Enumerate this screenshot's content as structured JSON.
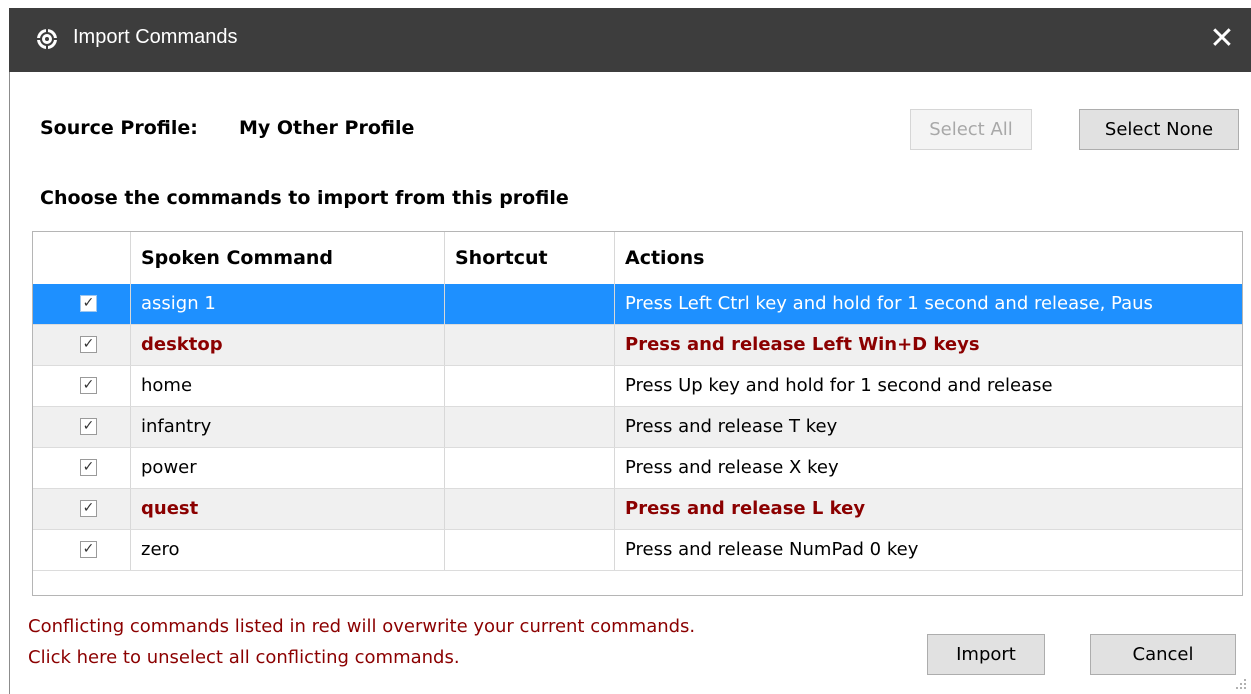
{
  "window": {
    "title": "Import Commands",
    "close_glyph": "✕",
    "icon": "gear-icon"
  },
  "source": {
    "label": "Source Profile:",
    "value": "My Other Profile"
  },
  "buttons": {
    "select_all": "Select All",
    "select_none": "Select None",
    "import": "Import",
    "cancel": "Cancel"
  },
  "instructions": "Choose the commands to import from this profile",
  "table": {
    "columns": [
      "Spoken Command",
      "Shortcut",
      "Actions"
    ],
    "rows": [
      {
        "checked": true,
        "command": "assign 1",
        "shortcut": "",
        "actions": "Press Left Ctrl key and hold for 1 second and release, Paus",
        "conflict": false,
        "selected": true
      },
      {
        "checked": true,
        "command": "desktop",
        "shortcut": "",
        "actions": "Press and release Left Win+D keys",
        "conflict": true,
        "selected": false
      },
      {
        "checked": true,
        "command": "home",
        "shortcut": "",
        "actions": "Press Up key and hold for 1 second and release",
        "conflict": false,
        "selected": false
      },
      {
        "checked": true,
        "command": "infantry",
        "shortcut": "",
        "actions": "Press and release T key",
        "conflict": false,
        "selected": false
      },
      {
        "checked": true,
        "command": "power",
        "shortcut": "",
        "actions": "Press and release X key",
        "conflict": false,
        "selected": false
      },
      {
        "checked": true,
        "command": "quest",
        "shortcut": "",
        "actions": "Press and release L key",
        "conflict": true,
        "selected": false
      },
      {
        "checked": true,
        "command": "zero",
        "shortcut": "",
        "actions": "Press and release NumPad 0 key",
        "conflict": false,
        "selected": false
      }
    ]
  },
  "notes": {
    "conflict_warning": "Conflicting commands listed in red will overwrite your current commands.",
    "unselect_link": "Click here to unselect all conflicting commands."
  },
  "colors": {
    "titlebar": "#3d3d3d",
    "selection": "#1e90ff",
    "conflict": "#8b0000"
  }
}
